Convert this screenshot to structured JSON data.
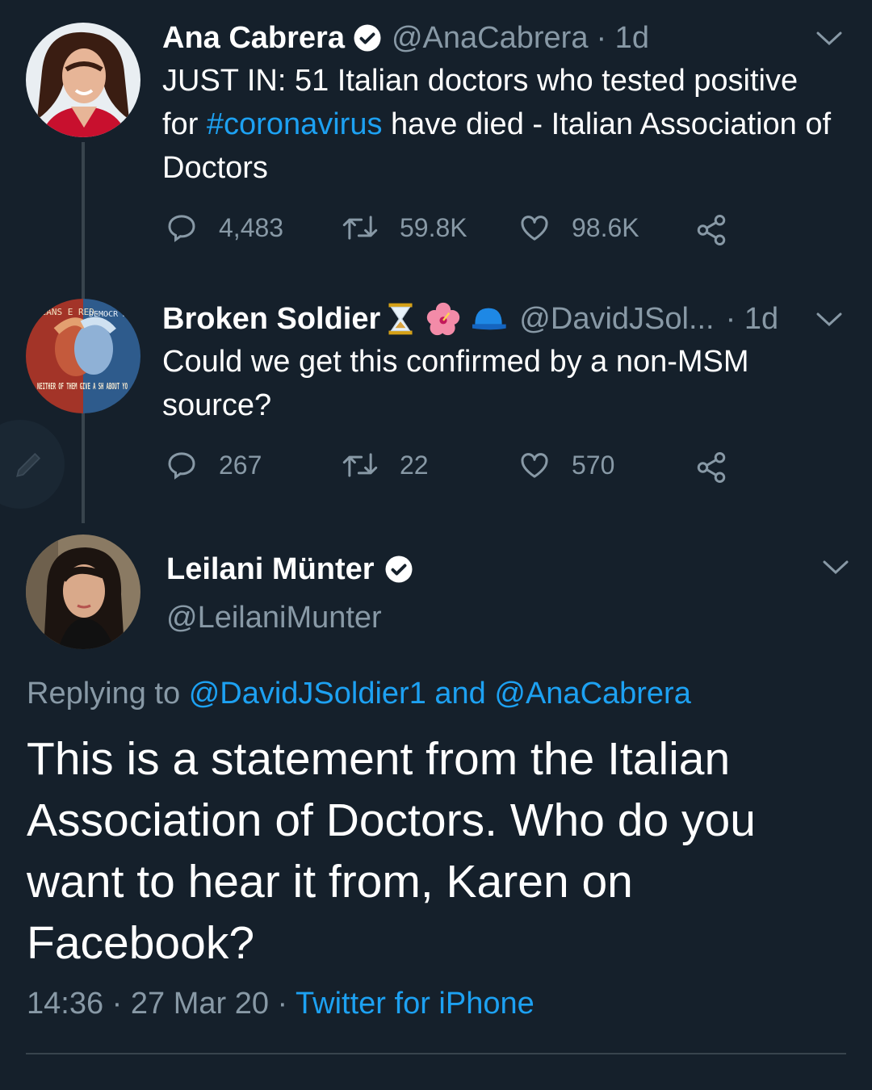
{
  "colors": {
    "background": "#15202b",
    "accent": "#1da1f2",
    "muted": "#8899a6",
    "line": "#38444d"
  },
  "tweet1": {
    "name": "Ana Cabrera",
    "handle": "@AnaCabrera",
    "time": "· 1d",
    "text_before": "JUST IN: 51 Italian doctors who tested positive for ",
    "hashtag": "#coronavirus",
    "text_after": " have died - Italian Association of Doctors",
    "replies": "4,483",
    "retweets": "59.8K",
    "likes": "98.6K"
  },
  "tweet2": {
    "name": "Broken Soldier",
    "emojis": [
      "hourglass-icon",
      "hibiscus-icon",
      "cap-icon"
    ],
    "handle": "@DavidJSol...",
    "time": "· 1d",
    "text": "Could we get this confirmed by a non-MSM source?",
    "replies": "267",
    "retweets": "22",
    "likes": "570",
    "avatar_text": {
      "top_left": "ICANS E RED...",
      "top_right": "DEMOCR ARE BLUE",
      "bottom": "NEITHER OF THEM GIVE A SH ABOUT YO"
    }
  },
  "main_tweet": {
    "name": "Leilani Münter",
    "handle": "@LeilaniMunter",
    "replying_label": "Replying to",
    "reply_mention_1": "@DavidJSoldier1",
    "reply_and": "and",
    "reply_mention_2": "@AnaCabrera",
    "text": "This is a statement from the Italian Association of Doctors. Who do you want to hear it from, Karen on Facebook?",
    "timestamp": "14:36 · 27 Mar 20 ·",
    "source": "Twitter for iPhone"
  },
  "compose_button": {
    "icon": "pencil-icon"
  }
}
